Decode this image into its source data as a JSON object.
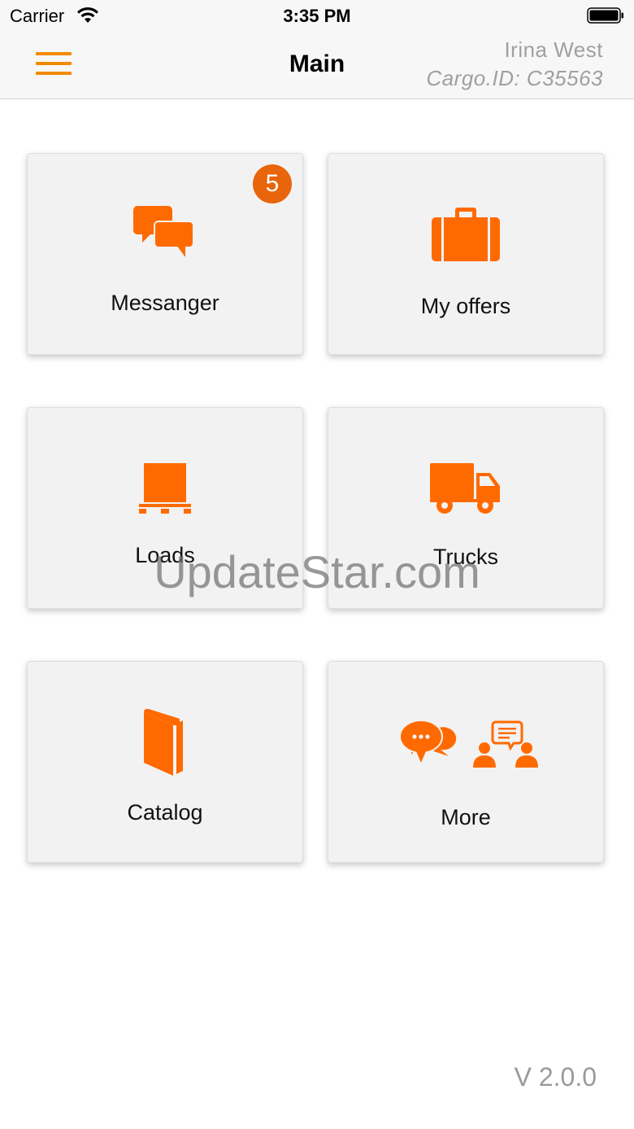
{
  "status_bar": {
    "carrier": "Carrier",
    "time": "3:35 PM",
    "wifi_icon": "wifi-icon",
    "battery_icon": "battery-icon"
  },
  "nav": {
    "title": "Main",
    "user_name": "Irina West",
    "cargo_id": "Cargo.ID: C35563",
    "menu_icon": "hamburger-menu-icon"
  },
  "tiles": [
    {
      "label": "Messanger",
      "icon": "chat-bubbles-icon",
      "badge": "5"
    },
    {
      "label": "My offers",
      "icon": "briefcase-icon"
    },
    {
      "label": "Loads",
      "icon": "pallet-box-icon"
    },
    {
      "label": "Trucks",
      "icon": "truck-icon"
    },
    {
      "label": "Catalog",
      "icon": "book-icon"
    },
    {
      "label": "More",
      "icon": "people-chat-icon"
    }
  ],
  "watermark": "UpdateStar.com",
  "version": "V 2.0.0",
  "colors": {
    "accent": "#ff6a00",
    "menu": "#f28a00",
    "badge": "#e8650b",
    "tile_bg": "#f2f2f2",
    "muted_text": "#a0a0a0"
  }
}
